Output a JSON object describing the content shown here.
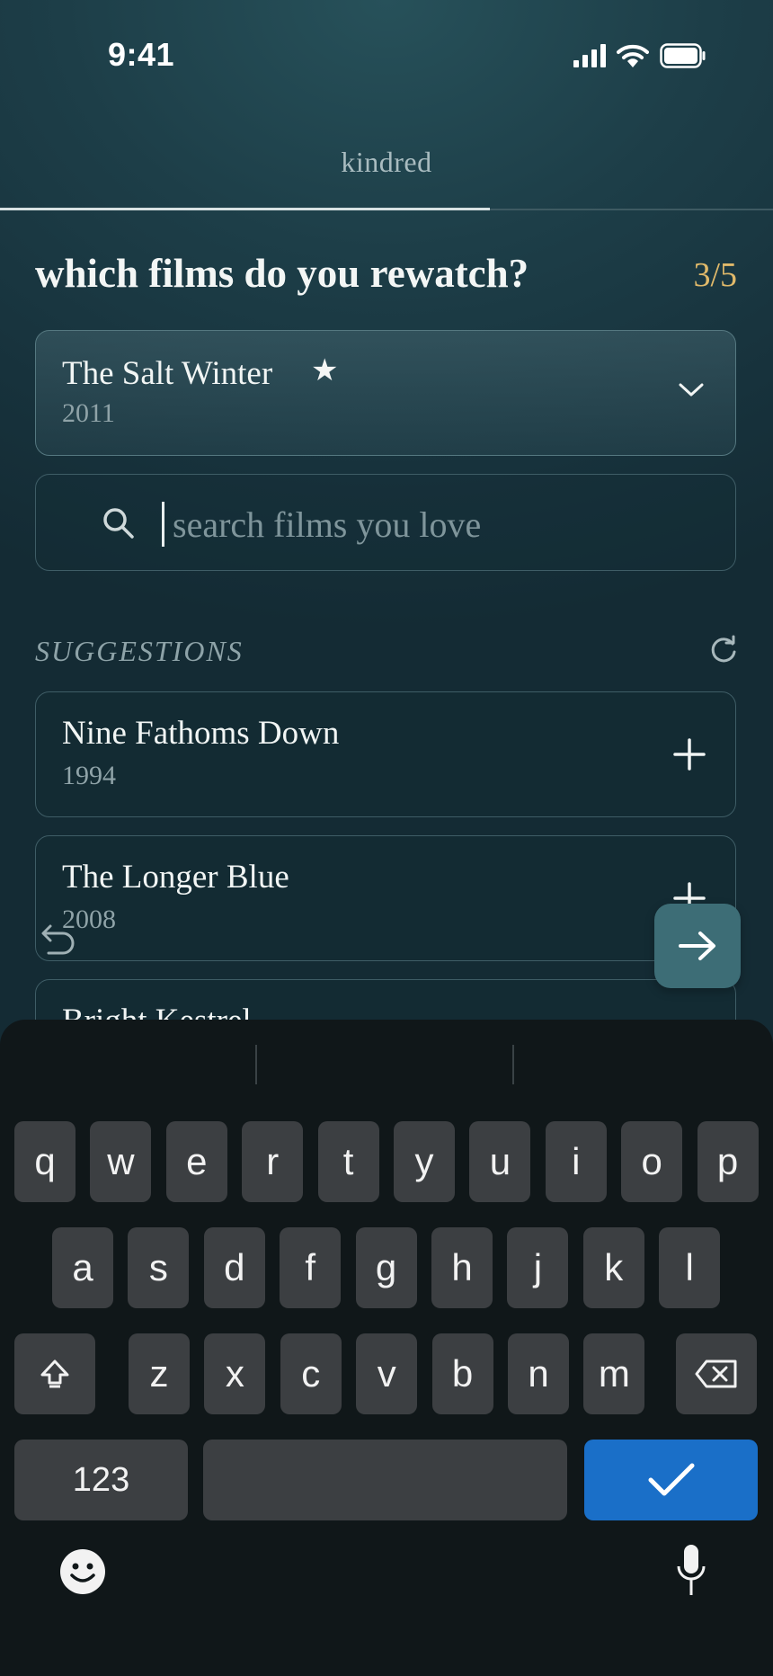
{
  "status": {
    "time": "9:41"
  },
  "app": {
    "brand": "kindred"
  },
  "progress": {
    "fraction": 0.634
  },
  "question": {
    "title": "which films do you rewatch?",
    "step": "3/5"
  },
  "selected_film": {
    "title": "The Salt Winter",
    "star": "★",
    "year": "2011"
  },
  "search": {
    "placeholder": "search films you love",
    "value": ""
  },
  "suggestions": {
    "heading": "SUGGESTIONS",
    "items": [
      {
        "title": "Nine Fathoms Down",
        "year": "1994"
      },
      {
        "title": "The Longer Blue",
        "year": "2008"
      },
      {
        "title": "Bright Kestrel",
        "year": ""
      }
    ]
  },
  "keyboard": {
    "row1": [
      "q",
      "w",
      "e",
      "r",
      "t",
      "y",
      "u",
      "i",
      "o",
      "p"
    ],
    "row2": [
      "a",
      "s",
      "d",
      "f",
      "g",
      "h",
      "j",
      "k",
      "l"
    ],
    "row3": [
      "z",
      "x",
      "c",
      "v",
      "b",
      "n",
      "m"
    ],
    "numbers_label": "123"
  },
  "colors": {
    "accent_gold": "#e0b96a",
    "done_blue": "#1a6fc8",
    "next_button": "#3d6d76"
  },
  "icons": [
    "signal-icon",
    "wifi-icon",
    "battery-icon",
    "star-icon",
    "chevron-down-icon",
    "search-icon",
    "refresh-icon",
    "plus-icon",
    "undo-icon",
    "arrow-right-icon",
    "shift-icon",
    "backspace-icon",
    "check-icon",
    "emoji-icon",
    "mic-icon"
  ]
}
